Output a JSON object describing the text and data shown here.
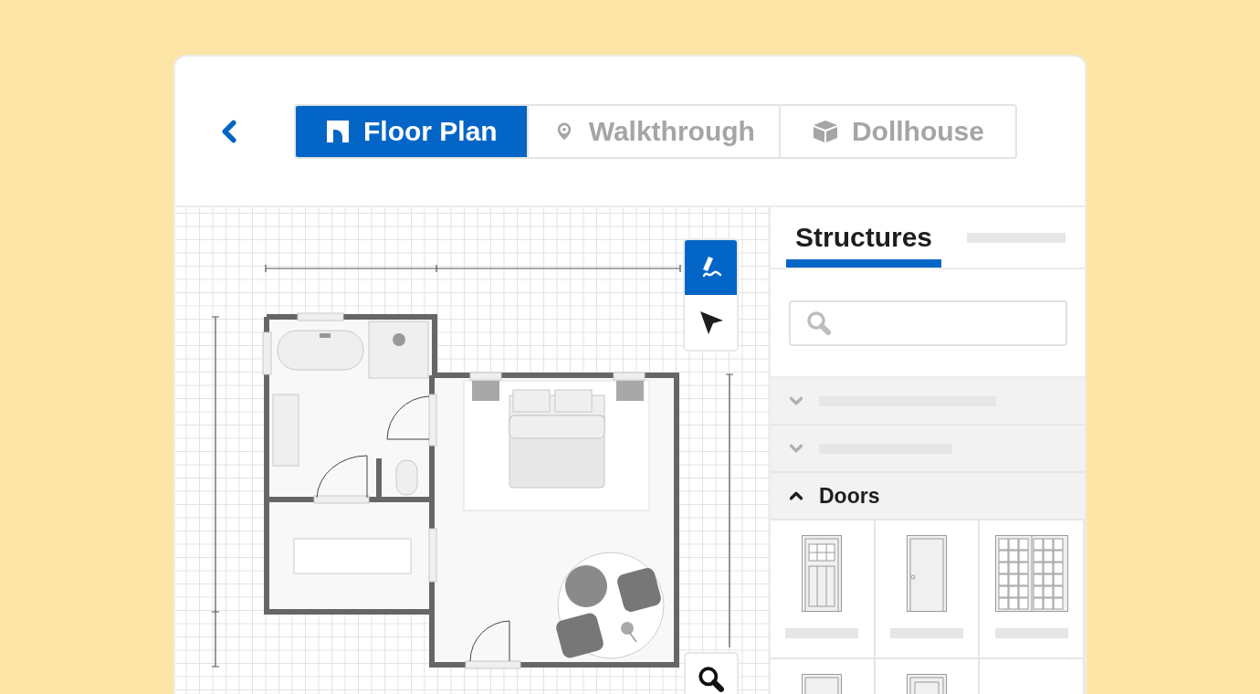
{
  "view_tabs": [
    {
      "label": "Floor Plan",
      "kind": "plan",
      "selected": true
    },
    {
      "label": "Walkthrough",
      "kind": "pin",
      "selected": false
    },
    {
      "label": "Dollhouse",
      "kind": "cube",
      "selected": false
    }
  ],
  "tools": [
    {
      "kind": "pen",
      "selected": true
    },
    {
      "kind": "pointer",
      "selected": false
    }
  ],
  "panel": {
    "tabs": [
      {
        "label": "Structures",
        "selected": true
      },
      {
        "kind": "placeholder",
        "selected": false
      }
    ],
    "sections": [
      {
        "expanded": false
      },
      {
        "expanded": false
      },
      {
        "label": "Doors",
        "expanded": true,
        "items": [
          {
            "kind": "paneled"
          },
          {
            "kind": "plain"
          },
          {
            "kind": "french"
          },
          {
            "kind": "framed"
          },
          {
            "kind": "inset"
          },
          {
            "kind": "empty"
          }
        ]
      }
    ]
  }
}
